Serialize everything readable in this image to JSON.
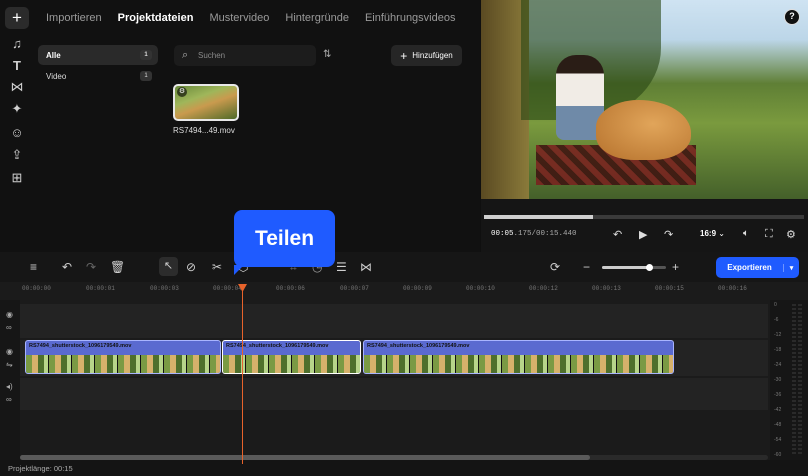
{
  "media_tabs": [
    "Importieren",
    "Projektdateien",
    "Mustervideo",
    "Hintergründe",
    "Einführungsvideos"
  ],
  "categories": [
    {
      "label": "Alle",
      "count": "1"
    },
    {
      "label": "Video",
      "count": "1"
    }
  ],
  "search": {
    "placeholder": "Suchen",
    "value": ""
  },
  "add_button": "Hinzufügen",
  "media_item": {
    "label": "RS7494...49.mov"
  },
  "tooltip": "Teilen",
  "preview": {
    "time_current": "00:05",
    "time_current_ms": ".175",
    "time_total": "/00:15.440",
    "aspect_ratio": "16:9",
    "progress": 0.34
  },
  "export": {
    "label": "Exportieren"
  },
  "ruler_ticks": [
    "00:00:00",
    "00:00:01",
    "00:00:03",
    "00:00:04",
    "00:00:06",
    "00:00:07",
    "00:00:09",
    "00:00:10",
    "00:00:12",
    "00:00:13",
    "00:00:15",
    "00:00:16"
  ],
  "clips": [
    {
      "title": "RS7494_shutterstock_1096179549.mov"
    },
    {
      "title": "RS7494_shutterstock_1096179549.mov"
    },
    {
      "title": "RS7494_shutterstock_1096179549.mov"
    }
  ],
  "meter_labels": [
    "0",
    "-6",
    "-12",
    "-18",
    "-24",
    "-30",
    "-36",
    "-42",
    "-48",
    "-54",
    "-60"
  ],
  "status": "Projektlänge: 00:15",
  "icons": {
    "rail": [
      "plus-icon",
      "music-icon",
      "text-icon",
      "transition-icon",
      "effects-icon",
      "sticker-icon",
      "import-icon",
      "templates-icon"
    ],
    "toolbar": [
      "add-track-icon",
      "undo-icon",
      "redo-icon",
      "delete-icon",
      "select-icon",
      "disable-icon",
      "split-icon",
      "marker-icon",
      "crop-icon",
      "speed-icon",
      "adjust-icon",
      "mask-icon",
      "snap-icon"
    ]
  },
  "colors": {
    "accent": "#1f5bff",
    "playhead": "#e8632b",
    "clip": "#5a6ad0"
  }
}
